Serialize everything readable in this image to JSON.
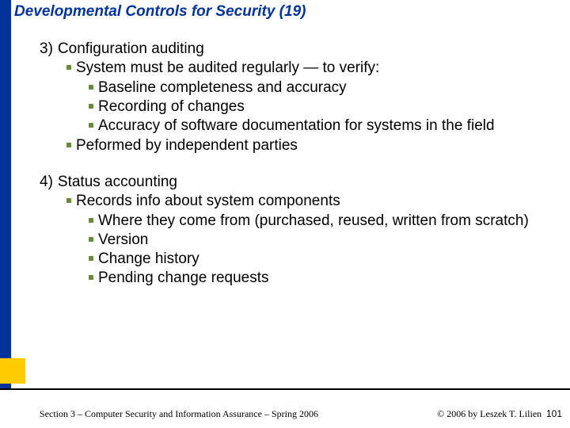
{
  "title": "Developmental Controls for Security (19)",
  "s3": {
    "num": "3)",
    "head": "Configuration auditing",
    "l1a": "System must be audited regularly — to verify:",
    "l2a": "Baseline completeness and accuracy",
    "l2b": "Recording of changes",
    "l2c": "Accuracy of software documentation for systems in the field",
    "l1b": "Peformed by independent parties"
  },
  "s4": {
    "num": "4)",
    "head": "Status accounting",
    "l1a": "Records info about system components",
    "l2a": "Where they come from (purchased, reused, written from scratch)",
    "l2b": "Version",
    "l2c": "Change history",
    "l2d": "Pending change requests"
  },
  "footer": {
    "left": "Section 3 – Computer Security and Information Assurance – Spring 2006",
    "copyright": "© 2006 by Leszek T. Lilien",
    "page": "101"
  }
}
